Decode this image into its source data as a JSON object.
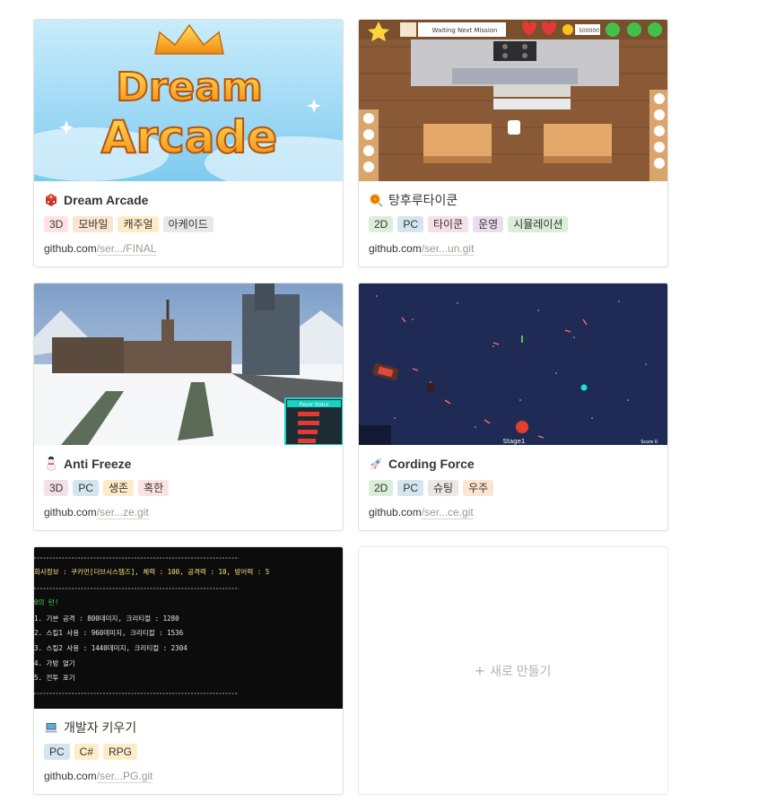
{
  "colors": {
    "tag_red": "#fde2e4",
    "tag_orange": "#fbe4d0",
    "tag_yellow": "#fdecc8",
    "tag_gray": "#e9e8e6",
    "tag_green": "#dbeddb",
    "tag_blue": "#d3e5ef",
    "tag_purple": "#e8deee",
    "tag_pink": "#f5e0e9"
  },
  "cards": [
    {
      "title": "Dream Arcade",
      "icon": "die-icon",
      "cover_text": [
        "Dream",
        "Arcade"
      ],
      "tags": [
        "3D",
        "모바일",
        "캐주얼",
        "아케이드"
      ],
      "url_domain": "github.com",
      "url_rest": "/ser.../FINAL"
    },
    {
      "title": "탕후루타이쿤",
      "icon": "candy-icon",
      "cover_text": [
        "Waiting Next Mission",
        "500000"
      ],
      "tags": [
        "2D",
        "PC",
        "타이쿤",
        "운영",
        "시뮬레이션"
      ],
      "url_domain": "github.com",
      "url_rest": "/ser...un.git"
    },
    {
      "title": "Anti Freeze",
      "icon": "snowman-icon",
      "cover_text": [
        "Player Status"
      ],
      "tags": [
        "3D",
        "PC",
        "생존",
        "혹한"
      ],
      "url_domain": "github.com",
      "url_rest": "/ser...ze.git"
    },
    {
      "title": "Cording Force",
      "icon": "rocket-icon",
      "cover_text": [
        "Stage1",
        "Score 0"
      ],
      "tags": [
        "2D",
        "PC",
        "슈팅",
        "우주"
      ],
      "url_domain": "github.com",
      "url_rest": "/ser...ce.git"
    },
    {
      "title": "개발자 키우기",
      "icon": "laptop-icon",
      "cover_text": [
        "회사정보 : 쿠카먼[더브시스템즈], 체력 : 100, 공격력 : 10, 방어력 : 5",
        "0의 턴!",
        "1. 기본 공격 : 800데미지, 크리티컬 : 1280",
        "2. 스킬1 사용 : 960데미지, 크리티컬 : 1536",
        "3. 스킬2 사용 : 1440데미지, 크리티컬 : 2304",
        "4. 가방 열기",
        "5. 전투 포기"
      ],
      "tags": [
        "PC",
        "C#",
        "RPG"
      ],
      "url_domain": "github.com",
      "url_rest": "/ser...PG.git"
    }
  ],
  "new_card_label": "새로 만들기"
}
